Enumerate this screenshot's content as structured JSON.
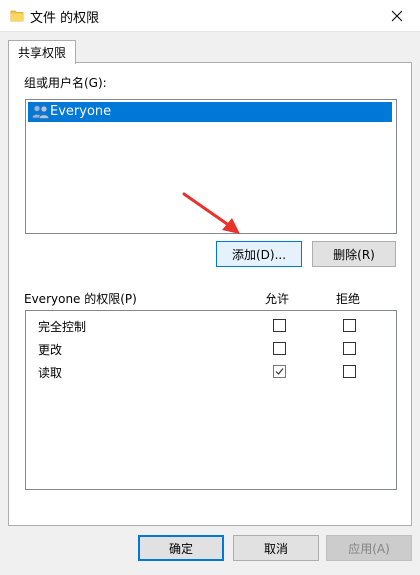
{
  "window": {
    "title": "文件 的权限",
    "icon": "folder-icon",
    "close_icon": "close-icon"
  },
  "tabs": [
    {
      "label": "共享权限",
      "selected": true
    }
  ],
  "users_section": {
    "label": "组或用户名(G):",
    "items": [
      {
        "name": "Everyone",
        "icon": "users-icon",
        "selected": true
      }
    ]
  },
  "buttons": {
    "add": "添加(D)...",
    "remove": "删除(R)",
    "ok": "确定",
    "cancel": "取消",
    "apply": "应用(A)"
  },
  "permissions_section": {
    "label": "Everyone 的权限(P)",
    "allow_header": "允许",
    "deny_header": "拒绝",
    "rows": [
      {
        "name": "完全控制",
        "allow": false,
        "deny": false
      },
      {
        "name": "更改",
        "allow": false,
        "deny": false
      },
      {
        "name": "读取",
        "allow": true,
        "deny": false
      }
    ]
  },
  "colors": {
    "selection": "#0078d7",
    "annotation_arrow": "#e8332a"
  }
}
